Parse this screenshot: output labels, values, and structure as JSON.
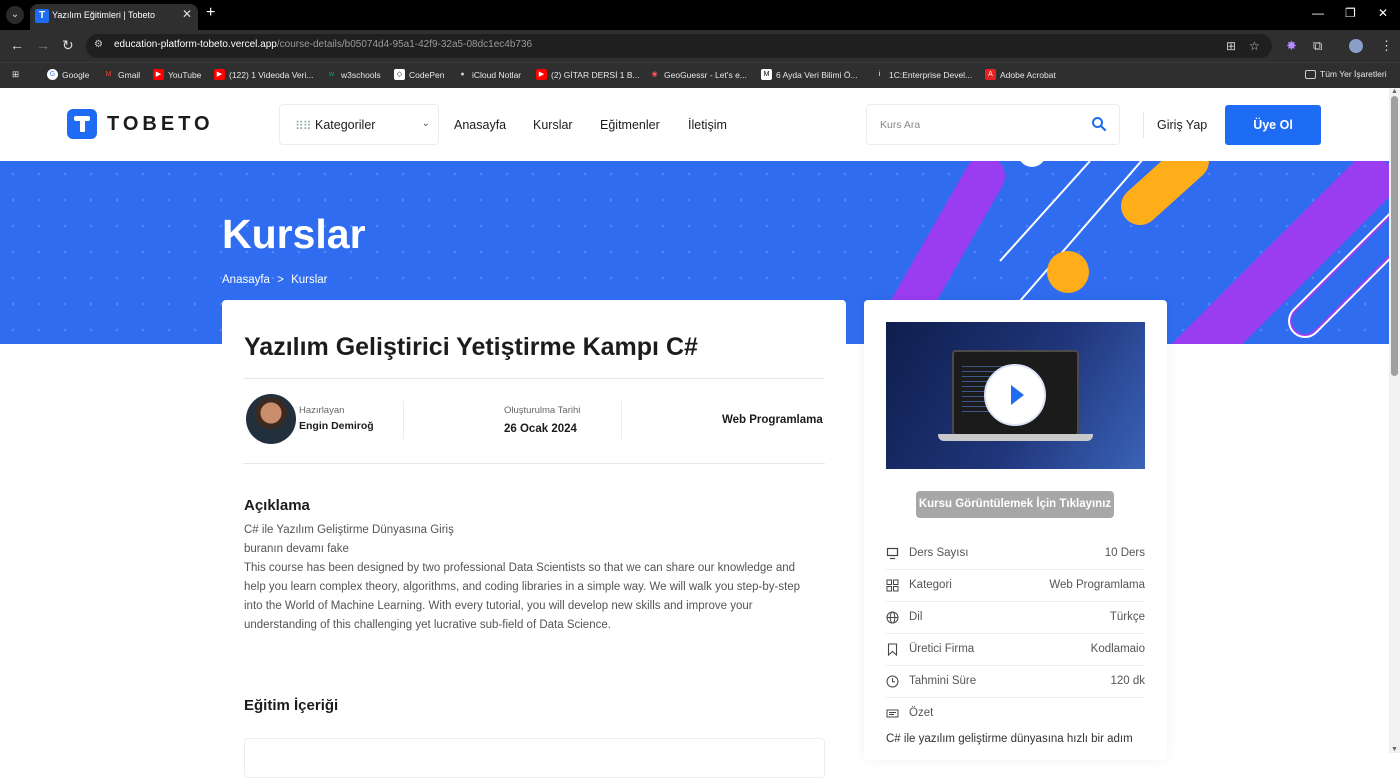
{
  "browser": {
    "tab_title": "Yazılım Eğitimleri | Tobeto",
    "tab_favicon": "T",
    "new_tab": "+",
    "url_host": "education-platform-tobeto.vercel.app",
    "url_path": "/course-details/b05074d4-95a1-42f9-32a5-08dc1ec4b736",
    "bookmarks": [
      {
        "label": "Google",
        "icon": "google-icon"
      },
      {
        "label": "Gmail",
        "icon": "gmail-icon"
      },
      {
        "label": "YouTube",
        "icon": "youtube-icon"
      },
      {
        "label": "(122) 1 Videoda Veri...",
        "icon": "youtube-icon"
      },
      {
        "label": "w3schools",
        "icon": "w3schools-icon"
      },
      {
        "label": "CodePen",
        "icon": "codepen-icon"
      },
      {
        "label": "iCloud Notlar",
        "icon": "apple-icon"
      },
      {
        "label": "(2) GİTAR DERSİ 1 B...",
        "icon": "youtube-icon"
      },
      {
        "label": "GeoGuessr - Let's e...",
        "icon": "geoguessr-icon"
      },
      {
        "label": "6 Ayda Veri Bilimi Ö...",
        "icon": "medium-icon"
      },
      {
        "label": "1C:Enterprise Devel...",
        "icon": "info-icon"
      },
      {
        "label": "Adobe Acrobat",
        "icon": "acrobat-icon"
      }
    ],
    "all_bookmarks": "Tüm Yer İşaretleri"
  },
  "header": {
    "logo_text": "TOBETO",
    "categories_label": "Kategoriler",
    "nav": [
      "Anasayfa",
      "Kurslar",
      "Eğitmenler",
      "İletişim"
    ],
    "search_placeholder": "Kurs Ara",
    "login_label": "Giriş Yap",
    "signup_label": "Üye Ol"
  },
  "hero": {
    "title": "Kurslar",
    "breadcrumb": [
      "Anasayfa",
      "Kurslar"
    ],
    "breadcrumb_sep": ">"
  },
  "course": {
    "title": "Yazılım Geliştirici Yetiştirme Kampı C#",
    "author_label": "Hazırlayan",
    "author_name": "Engin Demiroğ",
    "date_label": "Oluşturulma Tarihi",
    "date_value": "26 Ocak 2024",
    "category": "Web Programlama",
    "description_title": "Açıklama",
    "description_lines": [
      "C# ile Yazılım Geliştirme Dünyasına Giriş",
      "buranın devamı fake",
      "This course has been designed by two professional Data Scientists so that we can share our knowledge and",
      "help you learn complex theory, algorithms, and coding libraries in a simple way. We will walk you step-by-step",
      "into the World of Machine Learning. With every tutorial, you will develop new skills and improve your",
      "understanding of this challenging yet lucrative sub-field of Data Science."
    ],
    "content_title": "Eğitim İçeriği"
  },
  "sidebar": {
    "view_button": "Kursu Görüntülemek İçin Tıklayınız",
    "info": [
      {
        "label": "Ders Sayısı",
        "value": "10 Ders",
        "icon": "lesson-icon"
      },
      {
        "label": "Kategori",
        "value": "Web Programlama",
        "icon": "category-icon"
      },
      {
        "label": "Dil",
        "value": "Türkçe",
        "icon": "globe-icon"
      },
      {
        "label": "Üretici Firma",
        "value": "Kodlamaio",
        "icon": "bookmark-icon"
      },
      {
        "label": "Tahmini Süre",
        "value": "120 dk",
        "icon": "clock-icon"
      },
      {
        "label": "Özet",
        "value": "",
        "icon": "summary-icon"
      }
    ],
    "summary_text": "C# ile yazılım geliştirme dünyasına hızlı bir adım"
  },
  "colors": {
    "brand": "#1e6cf3",
    "hero_bg": "#2f6cf0",
    "deco_purple": "#9a3df0",
    "deco_orange": "#ffae1a"
  }
}
